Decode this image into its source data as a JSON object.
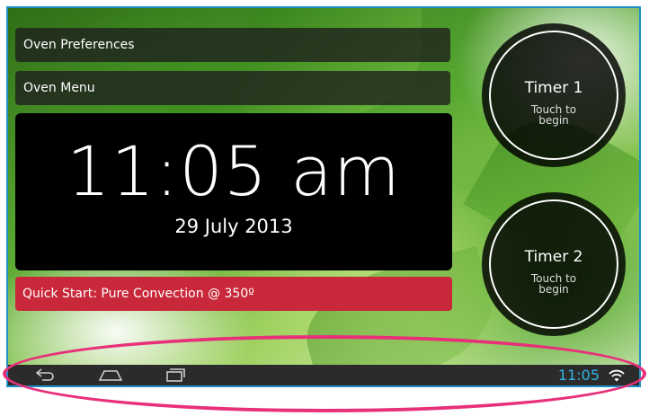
{
  "menu": {
    "preferences_label": "Oven Preferences",
    "oven_menu_label": "Oven Menu"
  },
  "clock": {
    "time": "11:05 am",
    "date": "29 July 2013"
  },
  "quick_start": {
    "label": "Quick Start: Pure Convection @ 350º"
  },
  "timers": [
    {
      "title": "Timer 1",
      "subtitle": "Touch to begin"
    },
    {
      "title": "Timer 2",
      "subtitle": "Touch to begin"
    }
  ],
  "status_bar": {
    "time": "11:05",
    "icons": [
      "back-icon",
      "home-icon",
      "recent-apps-icon",
      "wifi-icon"
    ],
    "time_color": "#33b5e5"
  },
  "colors": {
    "quick_start": "#c8283a",
    "frame_border": "#1e90c8",
    "highlight": "#e8307a"
  }
}
